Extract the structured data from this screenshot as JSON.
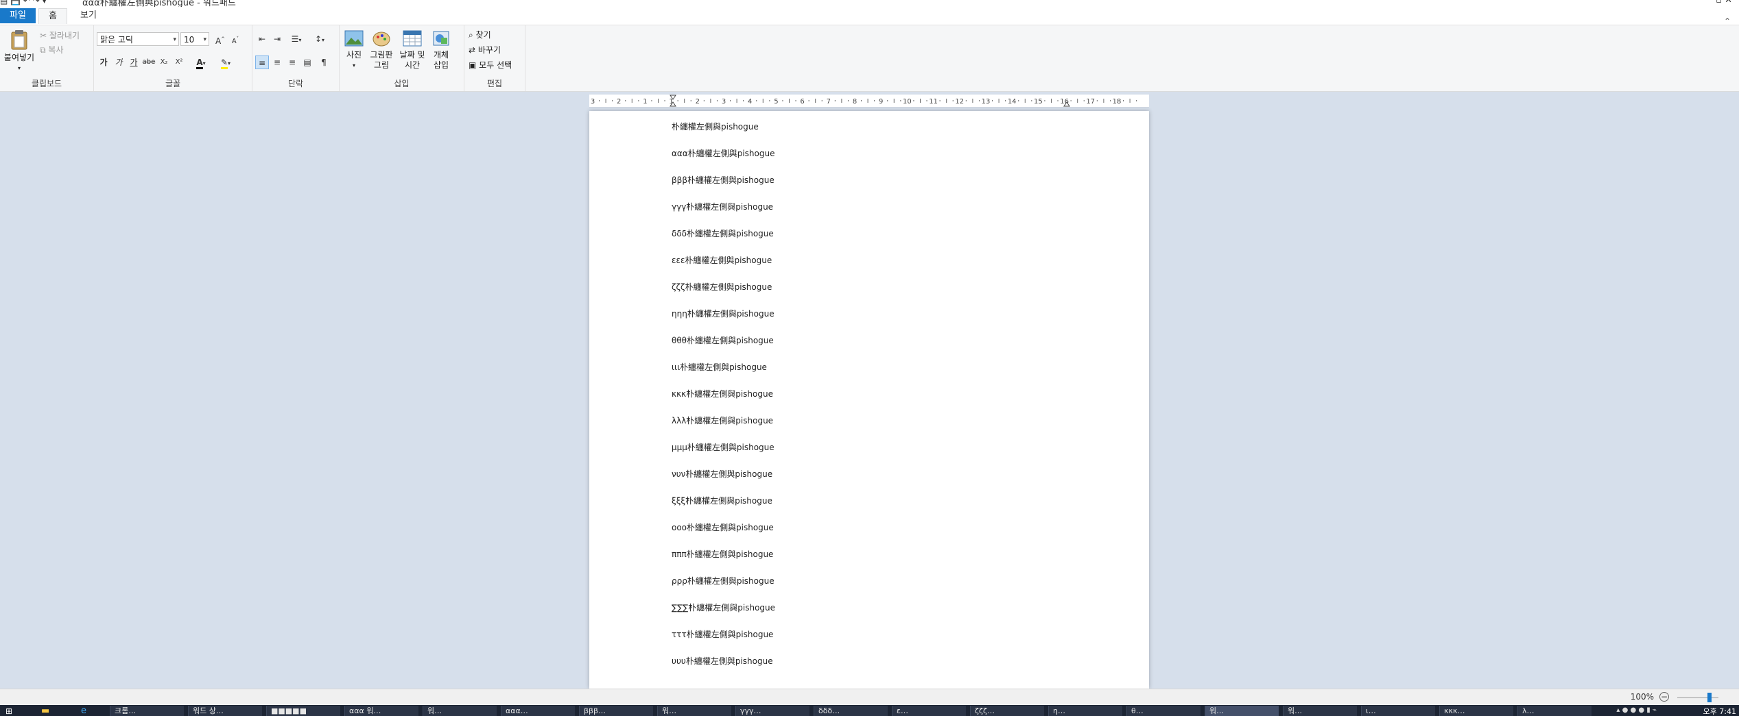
{
  "window": {
    "title": "ααα朴纏權左側與pishogue - 워드패드",
    "quick_access": "▤ 💾 ↶ ↷ ▾"
  },
  "tabs": [
    {
      "label": "파일"
    },
    {
      "label": "홈"
    },
    {
      "label": "보기"
    }
  ],
  "ribbon": {
    "clipboard": {
      "label": "클립보드",
      "paste_label": "붙여넣기",
      "cut_label": "잘라내기",
      "copy_label": "복사"
    },
    "font": {
      "label": "글꼴",
      "family": "맑은 고딕",
      "size": "10",
      "buttons": [
        "가",
        "가",
        "가",
        "abe",
        "X₂",
        "X²"
      ]
    },
    "paragraph": {
      "label": "단락"
    },
    "insert": {
      "label": "삽입",
      "picture_label": "사진",
      "paint_label_1": "그림판",
      "paint_label_2": "그림",
      "datetime_label_1": "날짜 및",
      "datetime_label_2": "시간",
      "object_label_1": "개체",
      "object_label_2": "삽입"
    },
    "editing": {
      "label": "편집",
      "find_label": "찾기",
      "replace_label": "바꾸기",
      "selectall_label": "모두 선택"
    }
  },
  "ruler": {
    "labels": [
      "3",
      "2",
      "1",
      "1",
      "2",
      "3",
      "4",
      "5",
      "6",
      "7",
      "8",
      "9",
      "10",
      "11",
      "12",
      "13",
      "14",
      "15",
      "16",
      "17",
      "18"
    ]
  },
  "document": {
    "lines": [
      "朴纏權左側與pishogue",
      "ααα朴纏權左側與pishogue",
      "βββ朴纏權左側與pishogue",
      "γγγ朴纏權左側與pishogue",
      "δδδ朴纏權左側與pishogue",
      "εεε朴纏權左側與pishogue",
      "ζζζ朴纏權左側與pishogue",
      "ηηη朴纏權左側與pishogue",
      "θθθ朴纏權左側與pishogue",
      "ιιι朴纏權左側與pishogue",
      "κκκ朴纏權左側與pishogue",
      "λλλ朴纏權左側與pishogue",
      "μμμ朴纏權左側與pishogue",
      "νυν朴纏權左側與pishogue",
      "ξξξ朴纏權左側與pishogue",
      "οοο朴纏權左側與pishogue",
      "πππ朴纏權左側與pishogue",
      "ρρρ朴纏權左側與pishogue",
      "∑∑∑朴纏權左側與pishogue",
      "τττ朴纏權左側與pishogue",
      "υυυ朴纏權左側與pishogue"
    ]
  },
  "status": {
    "zoom": "100%"
  },
  "taskbar": {
    "clock": "오후 7:41",
    "items": [
      "크롬…",
      "워드 상…",
      "■■■■■",
      "ααα 워…",
      "워…",
      "ααα…",
      "βββ…",
      "워…",
      "γγγ…",
      "δδδ…",
      "ε…",
      "ζζζ…",
      "η…",
      "θ…",
      "워…",
      "워…",
      "ι…",
      "κκκ…",
      "λ…"
    ]
  },
  "colors": {
    "accent": "#1979ca",
    "workspace": "#d6dfeb"
  }
}
